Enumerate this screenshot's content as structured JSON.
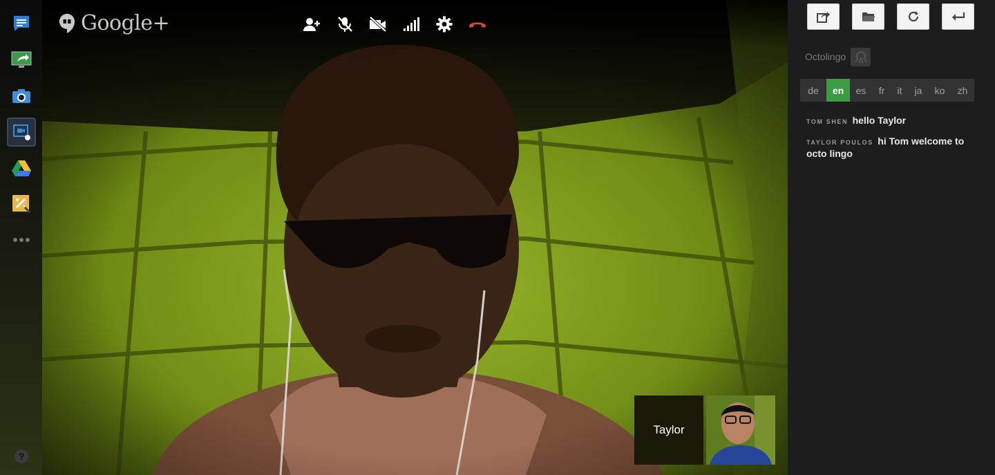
{
  "app": {
    "brand": "Google+"
  },
  "rail": {
    "items": [
      {
        "name": "chat",
        "icon": "chat-icon"
      },
      {
        "name": "screenshare",
        "icon": "screenshare-icon"
      },
      {
        "name": "capture",
        "icon": "camera-icon"
      },
      {
        "name": "hangout-app",
        "icon": "hangout-app-icon",
        "active": true
      },
      {
        "name": "drive",
        "icon": "drive-icon"
      },
      {
        "name": "effects",
        "icon": "effects-icon"
      },
      {
        "name": "more",
        "icon": "more-icon"
      }
    ],
    "help_label": "?"
  },
  "controls": [
    "invite-icon",
    "mute-mic-icon",
    "video-off-icon",
    "bandwidth-icon",
    "settings-icon",
    "hangup-icon"
  ],
  "participant": {
    "name": "Taylor"
  },
  "panel": {
    "buttons": [
      "share-icon",
      "folder-icon",
      "refresh-icon",
      "back-icon"
    ],
    "app_title": "Octolingo",
    "languages": [
      {
        "code": "de"
      },
      {
        "code": "en",
        "active": true
      },
      {
        "code": "es"
      },
      {
        "code": "fr"
      },
      {
        "code": "it"
      },
      {
        "code": "ja"
      },
      {
        "code": "ko"
      },
      {
        "code": "zh"
      }
    ],
    "messages": [
      {
        "author": "Tom Shen",
        "text": "hello Taylor"
      },
      {
        "author": "Taylor Poulos",
        "text": "hi Tom welcome to octo lingo"
      }
    ]
  },
  "colors": {
    "accent_green": "#3c9b45",
    "hangup_red": "#e0483a",
    "panel_bg": "#1d1d1d"
  }
}
